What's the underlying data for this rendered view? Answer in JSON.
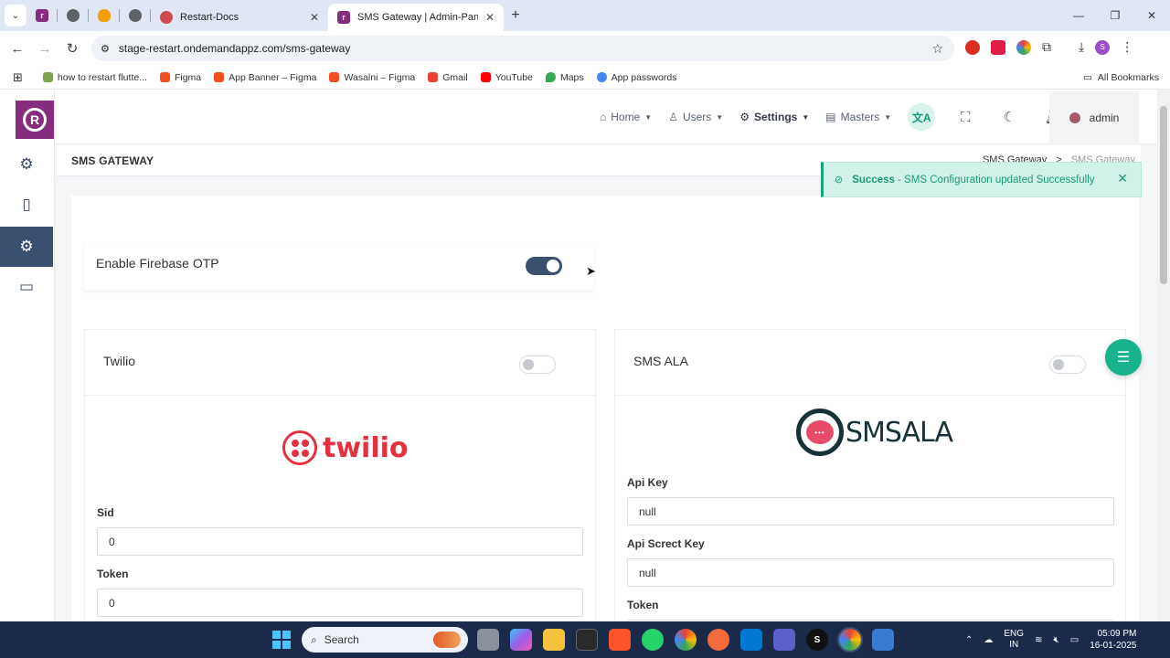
{
  "browser": {
    "pinned_tabs": [
      {
        "icon": "app-r-favicon",
        "color": "#862d80"
      },
      {
        "icon": "globe-favicon",
        "color": "#5f6368"
      },
      {
        "icon": "fire-favicon",
        "color": "#f59e0b"
      },
      {
        "icon": "globe-favicon",
        "color": "#5f6368"
      }
    ],
    "tabs": [
      {
        "title": "Restart-Docs",
        "icon": "restart-docs-favicon"
      },
      {
        "title": "SMS Gateway | Admin-Panel",
        "icon": "app-r-favicon"
      }
    ],
    "url": "stage-restart.ondemandappz.com/sms-gateway",
    "profile_letter": "S",
    "bookmarks": [
      {
        "label": "how to restart flutte...",
        "icon": "bookmark-favicon"
      },
      {
        "label": "Figma",
        "icon": "figma-icon"
      },
      {
        "label": "App Banner – Figma",
        "icon": "figma-icon"
      },
      {
        "label": "Wasalni – Figma",
        "icon": "figma-icon"
      },
      {
        "label": "Gmail",
        "icon": "gmail-icon"
      },
      {
        "label": "YouTube",
        "icon": "youtube-icon"
      },
      {
        "label": "Maps",
        "icon": "maps-icon"
      },
      {
        "label": "App passwords",
        "icon": "google-icon"
      }
    ],
    "all_bookmarks": "All Bookmarks"
  },
  "topbar": {
    "menu": [
      {
        "label": "Home",
        "icon": "home-icon"
      },
      {
        "label": "Users",
        "icon": "user-icon"
      },
      {
        "label": "Settings",
        "icon": "gear-icon"
      },
      {
        "label": "Masters",
        "icon": "document-icon"
      }
    ],
    "admin": "admin"
  },
  "page": {
    "title": "SMS GATEWAY",
    "breadcrumb": [
      "SMS Gateway",
      "SMS Gateway"
    ]
  },
  "toast": {
    "status": "Success",
    "message": "- SMS Configuration updated Successfully"
  },
  "firebase": {
    "label": "Enable Firebase OTP",
    "enabled": true
  },
  "twilio": {
    "name": "Twilio",
    "enabled": false,
    "logo_text": "twilio",
    "fields": [
      {
        "label": "Sid",
        "value": "0"
      },
      {
        "label": "Token",
        "value": "0"
      }
    ]
  },
  "smsala": {
    "name": "SMS ALA",
    "enabled": false,
    "logo_text": "SMSALA",
    "fields": [
      {
        "label": "Api Key",
        "value": "null"
      },
      {
        "label": "Api Screct Key",
        "value": "null"
      },
      {
        "label": "Token",
        "value": ""
      }
    ]
  },
  "taskbar": {
    "search_placeholder": "Search",
    "lang": [
      "ENG",
      "IN"
    ],
    "time": "05:09 PM",
    "date": "16-01-2025"
  },
  "colors": {
    "primary": "#3b4f70",
    "brand": "#862d80",
    "success": "#1aa37f",
    "fab": "#16b38c"
  }
}
